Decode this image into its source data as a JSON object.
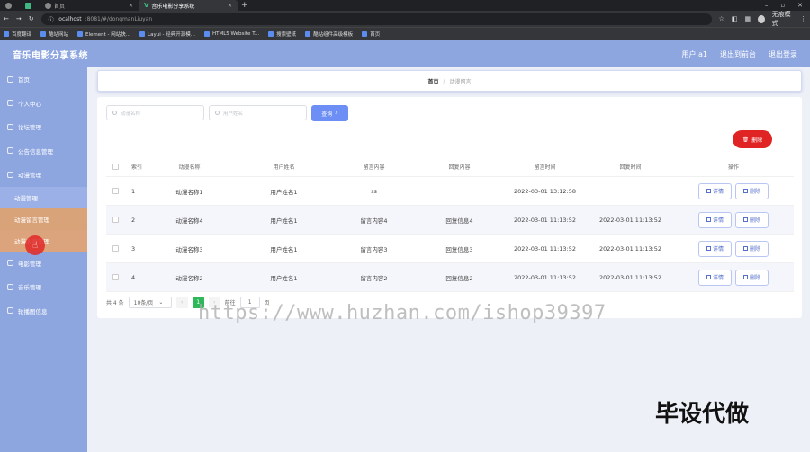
{
  "browser": {
    "tabs": [
      {
        "label": ""
      },
      {
        "label": ""
      },
      {
        "label": "首页"
      },
      {
        "label": "音乐电影分享系统"
      }
    ],
    "url_host": "localhost",
    "url_path": ":8081/#/dongmanLiuyan",
    "profile_label": "无痕模式",
    "bookmarks": [
      "百度翻译",
      "酷站网站",
      "Element - 网站快...",
      "Layui - 经典开源模...",
      "HTML5 Website T...",
      "搜索壁纸",
      "酷站组件高级模板",
      "首页"
    ]
  },
  "header": {
    "title": "音乐电影分享系统",
    "user": "用户 a1",
    "back_to_front": "退出到前台",
    "logout": "退出登录"
  },
  "sidebar": {
    "items": [
      {
        "label": "首页"
      },
      {
        "label": "个人中心"
      },
      {
        "label": "论坛管理"
      },
      {
        "label": "公告信息管理"
      },
      {
        "label": "动漫管理"
      }
    ],
    "subitems": [
      {
        "label": "动漫管理"
      },
      {
        "label": "动漫留言管理"
      },
      {
        "label": "动漫收藏管理"
      }
    ],
    "items_after": [
      {
        "label": "电影管理"
      },
      {
        "label": "音乐管理"
      },
      {
        "label": "轮播图信息"
      }
    ]
  },
  "breadcrumb": {
    "home": "首页",
    "separator": "/",
    "current": "动漫留言"
  },
  "search": {
    "placeholder1": "动漫名称",
    "placeholder2": "用户姓名",
    "query_label": "查询"
  },
  "delete_button": "删除",
  "table": {
    "headers": [
      "索引",
      "动漫名称",
      "用户姓名",
      "留言内容",
      "回复内容",
      "留言时间",
      "回复时间",
      "操作"
    ],
    "rows": [
      {
        "index": "1",
        "name": "动漫名称1",
        "user": "用户姓名1",
        "content": "ss",
        "reply": "",
        "time": "2022-03-01 13:12:58",
        "reply_time": ""
      },
      {
        "index": "2",
        "name": "动漫名称4",
        "user": "用户姓名1",
        "content": "留言内容4",
        "reply": "回复信息4",
        "time": "2022-03-01 11:13:52",
        "reply_time": "2022-03-01 11:13:52"
      },
      {
        "index": "3",
        "name": "动漫名称3",
        "user": "用户姓名1",
        "content": "留言内容3",
        "reply": "回复信息3",
        "time": "2022-03-01 11:13:52",
        "reply_time": "2022-03-01 11:13:52"
      },
      {
        "index": "4",
        "name": "动漫名称2",
        "user": "用户姓名1",
        "content": "留言内容2",
        "reply": "回复信息2",
        "time": "2022-03-01 11:13:52",
        "reply_time": "2022-03-01 11:13:52"
      }
    ],
    "detail_label": "详情",
    "delete_label": "删除"
  },
  "pagination": {
    "total": "共 4 条",
    "page_size": "10条/页",
    "current_page": "1",
    "goto_label": "前往",
    "goto_value": "1",
    "page_unit": "页"
  },
  "watermark": "https://www.huzhan.com/ishop39397",
  "corner_text": "毕设代做",
  "colors": {
    "header_bg": "#8ea6e0",
    "query_button": "#6c8ef5",
    "delete_button": "#e02424",
    "active_menu": "#d9a37a",
    "current_page": "#2fb85a"
  }
}
